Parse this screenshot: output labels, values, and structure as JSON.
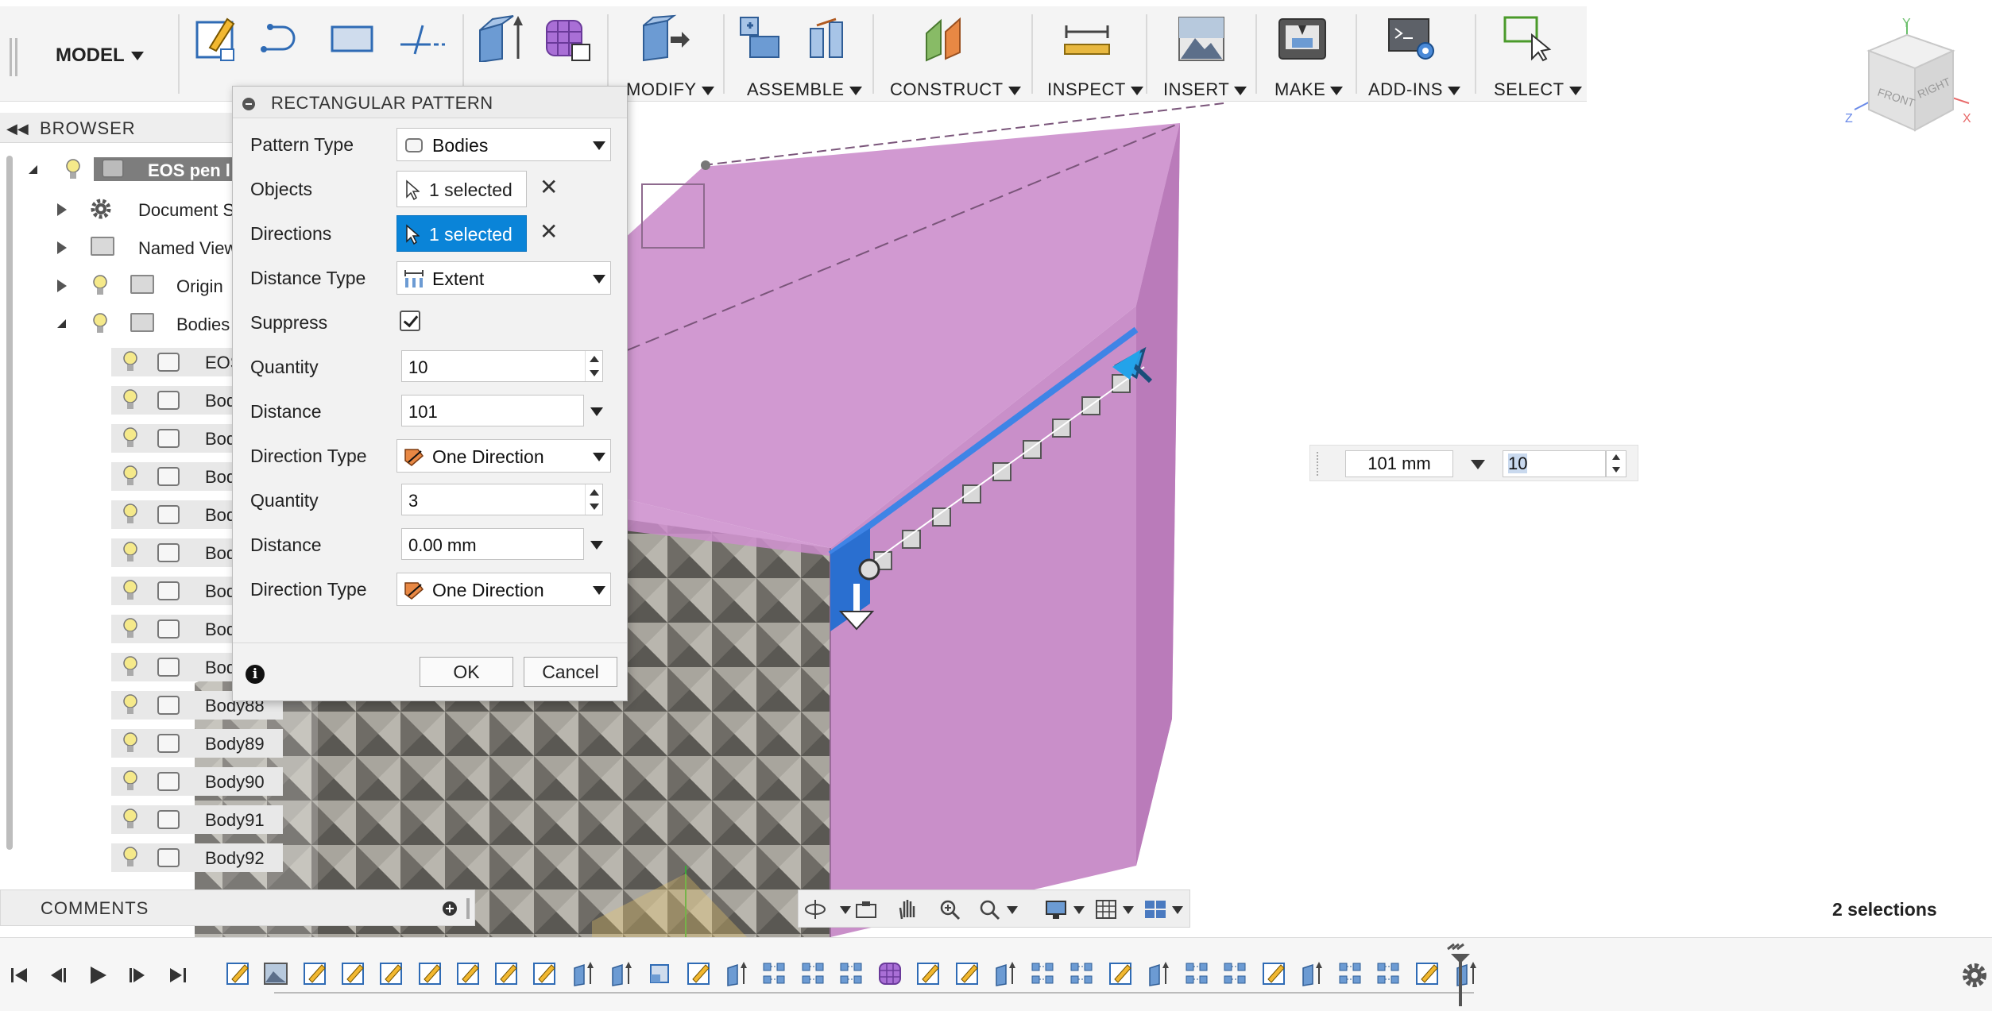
{
  "workspace": {
    "label": "MODEL"
  },
  "toolbar": {
    "groups": [
      {
        "label": "MODIFY"
      },
      {
        "label": "ASSEMBLE"
      },
      {
        "label": "CONSTRUCT"
      },
      {
        "label": "INSPECT"
      },
      {
        "label": "INSERT"
      },
      {
        "label": "MAKE"
      },
      {
        "label": "ADD-INS"
      },
      {
        "label": "SELECT"
      }
    ]
  },
  "browser": {
    "title": "BROWSER",
    "root": "EOS pen l",
    "items": [
      {
        "label": "Document S"
      },
      {
        "label": "Named View"
      },
      {
        "label": "Origin"
      },
      {
        "label": "Bodies"
      }
    ],
    "bodies": [
      "EOS",
      "Bod",
      "Bod",
      "Bod",
      "Bod",
      "Bod",
      "Bod",
      "Bod",
      "Bod",
      "Body88",
      "Body89",
      "Body90",
      "Body91",
      "Body92"
    ]
  },
  "dialog": {
    "title": "RECTANGULAR PATTERN",
    "pattern_type": {
      "label": "Pattern Type",
      "value": "Bodies"
    },
    "objects": {
      "label": "Objects",
      "value": "1 selected"
    },
    "directions": {
      "label": "Directions",
      "value": "1 selected"
    },
    "distance_type": {
      "label": "Distance Type",
      "value": "Extent"
    },
    "suppress": {
      "label": "Suppress",
      "checked": true
    },
    "quantity1": {
      "label": "Quantity",
      "value": "10"
    },
    "distance1": {
      "label": "Distance",
      "value": "101"
    },
    "direction_type1": {
      "label": "Direction Type",
      "value": "One Direction"
    },
    "quantity2": {
      "label": "Quantity",
      "value": "3"
    },
    "distance2": {
      "label": "Distance",
      "value": "0.00 mm"
    },
    "direction_type2": {
      "label": "Direction Type",
      "value": "One Direction"
    },
    "ok": "OK",
    "cancel": "Cancel"
  },
  "heads_up": {
    "distance": "101 mm",
    "quantity": "10"
  },
  "viewcube": {
    "front": "FRONT",
    "right": "RIGHT",
    "axis_x": "X",
    "axis_y": "Y",
    "axis_z": "Z"
  },
  "comments": {
    "title": "COMMENTS"
  },
  "status": {
    "selections": "2 selections"
  },
  "colors": {
    "accent": "#0a84d8",
    "body_pink": "#d08fd0",
    "texture_grey": "#8c8a82"
  },
  "timeline": {
    "feature_count": 33
  }
}
